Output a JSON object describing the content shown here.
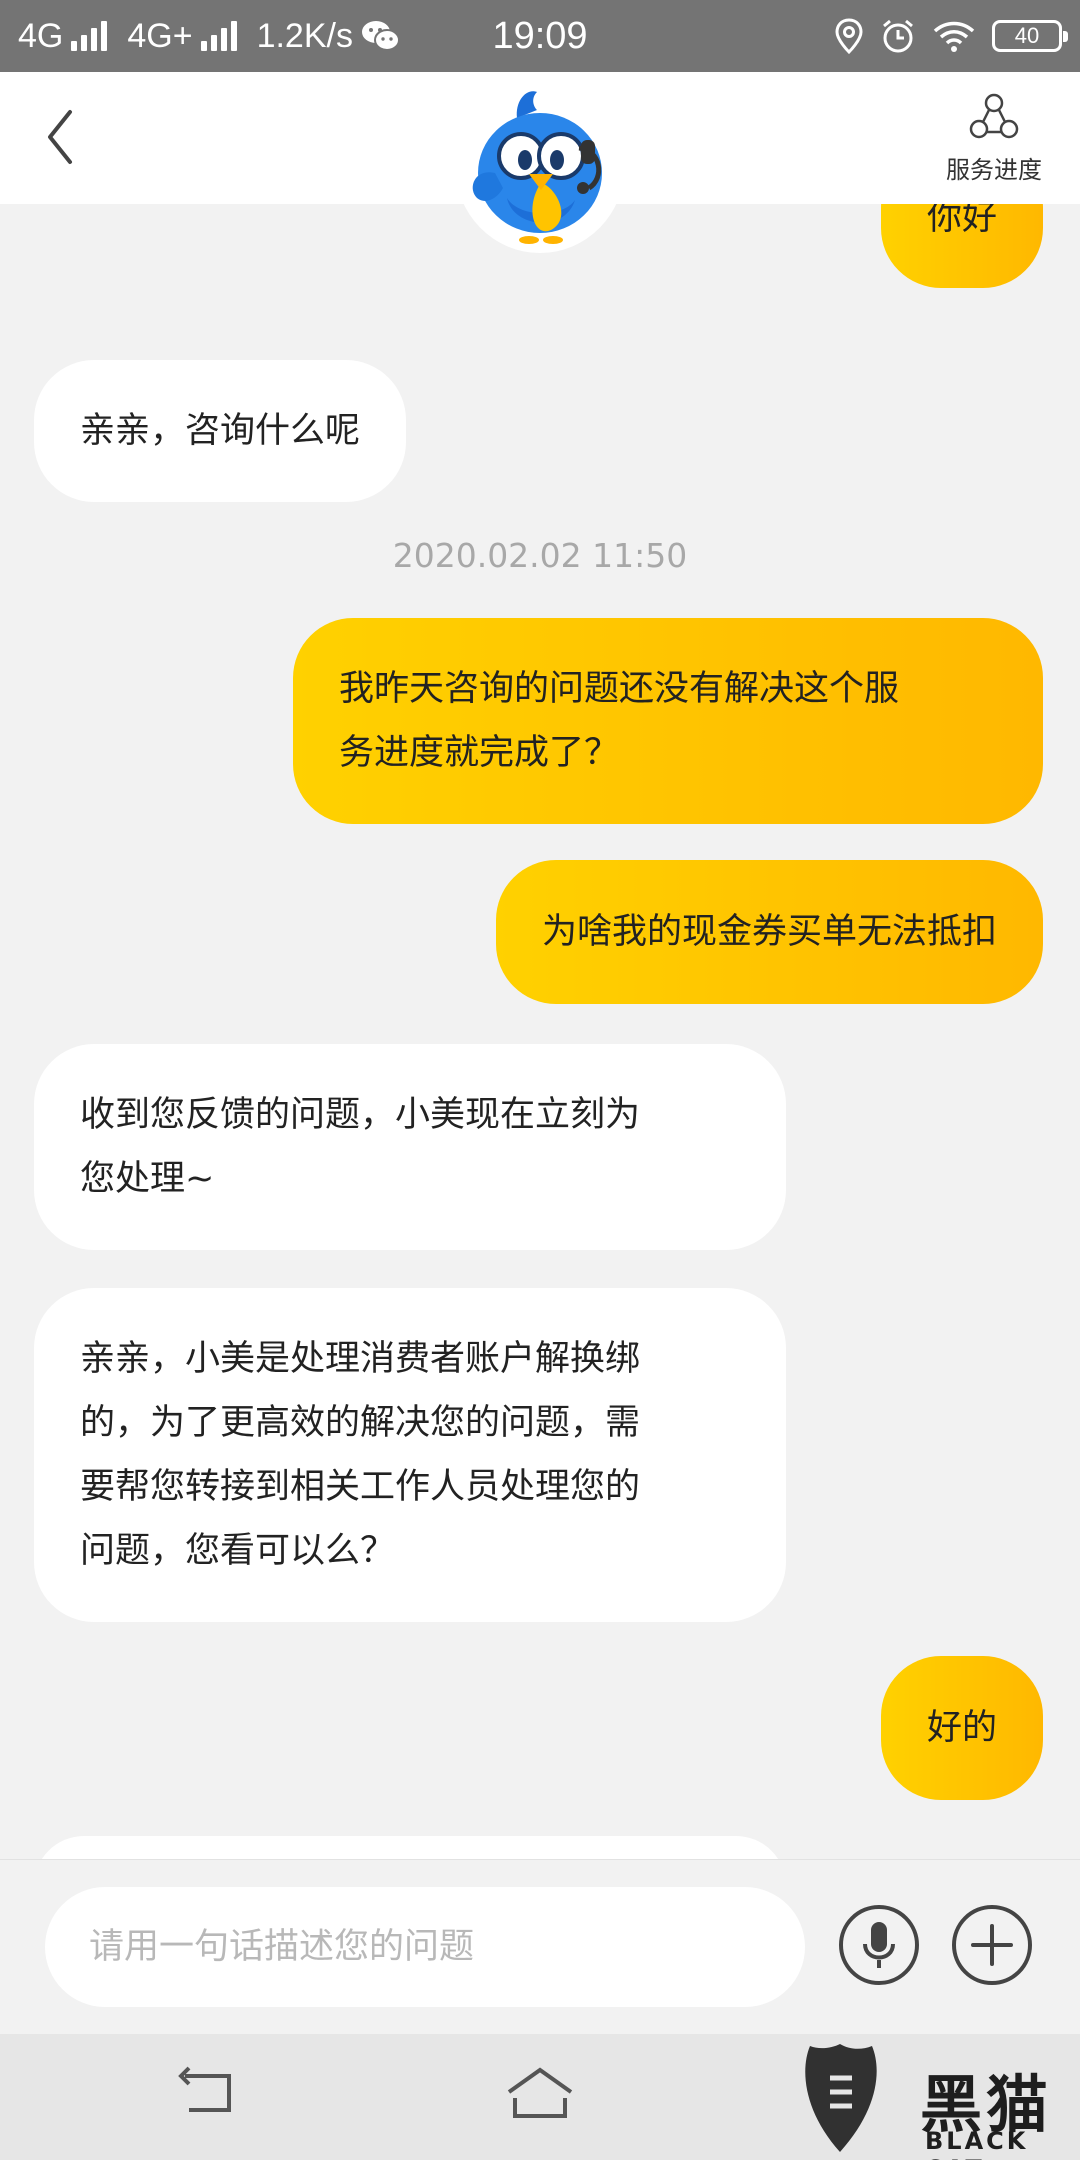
{
  "status_bar": {
    "network_1": "4G",
    "network_2": "4G+",
    "speed": "1.2K/s",
    "time": "19:09",
    "battery": "40"
  },
  "header": {
    "service_progress_label": "服务进度",
    "avatar_icon": "blue-bird-mascot-icon"
  },
  "messages": [
    {
      "side": "out",
      "text": "你好"
    },
    {
      "side": "in",
      "text": "亲亲，咨询什么呢"
    },
    {
      "timestamp": "2020.02.02 11:50"
    },
    {
      "side": "out",
      "lines": [
        "我昨天咨询的问题还没有解决这个服",
        "务进度就完成了？"
      ]
    },
    {
      "side": "out",
      "text": "为啥我的现金券买单无法抵扣"
    },
    {
      "side": "in",
      "lines": [
        "收到您反馈的问题，小美现在立刻为",
        "您处理~"
      ]
    },
    {
      "side": "in",
      "lines": [
        "亲亲，小美是处理消费者账户解换绑",
        "的，为了更高效的解决您的问题，需",
        "要帮您转接到相关工作人员处理您的",
        "问题，您看可以么？"
      ]
    },
    {
      "side": "out",
      "text": "好的"
    }
  ],
  "input": {
    "placeholder": "请用一句话描述您的问题",
    "value": ""
  },
  "watermark": {
    "text": "黑猫",
    "sub": "BLACK CAT"
  },
  "colors": {
    "outgoing_bubble": "#ffc400",
    "incoming_bubble": "#ffffff",
    "background": "#f2f2f2",
    "status_bar": "#747474"
  }
}
